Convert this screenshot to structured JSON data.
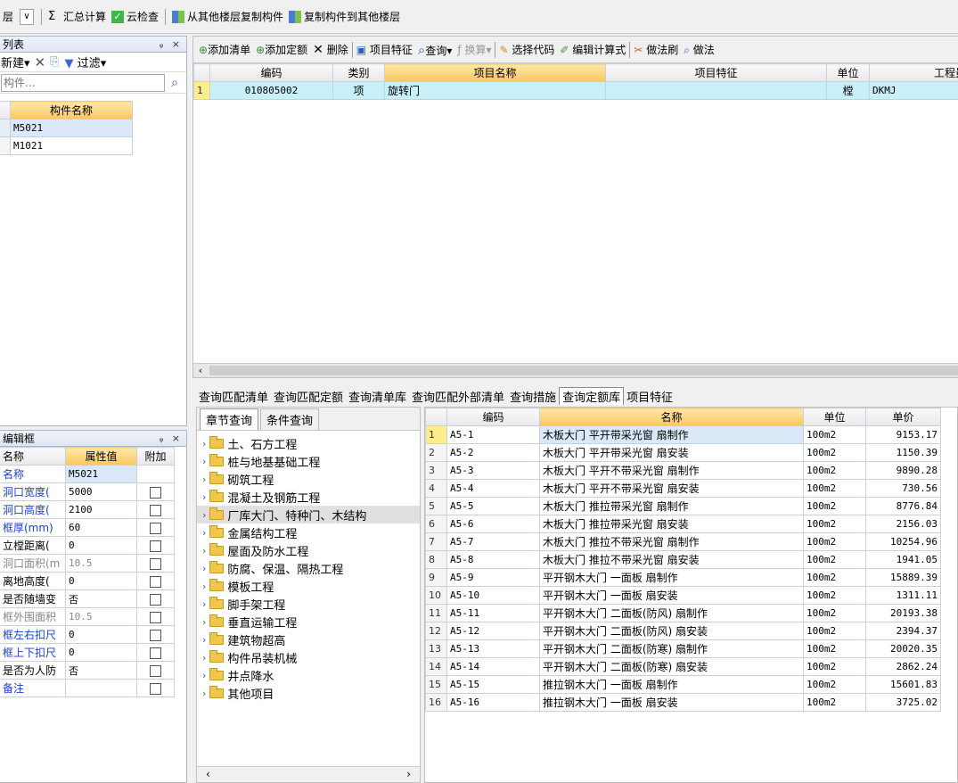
{
  "toolbar": {
    "floor_label": "层",
    "sum_calc": "汇总计算",
    "cloud_check": "云检查",
    "copy_from_floor": "从其他楼层复制构件",
    "copy_to_floor": "复制构件到其他楼层"
  },
  "component_list": {
    "title": "列表",
    "new_label": "新建",
    "filter_label": "过滤",
    "search_placeholder": "构件...",
    "column_header": "构件名称",
    "items": [
      "M5021",
      "M1021"
    ]
  },
  "list_toolbar": {
    "add_list": "添加清单",
    "add_quota": "添加定额",
    "delete": "删除",
    "item_feature": "项目特征",
    "query": "查询",
    "convert": "换算",
    "select_code": "选择代码",
    "edit_formula": "编辑计算式",
    "method_brush": "做法刷",
    "method_query": "做法"
  },
  "list_table": {
    "headers": [
      "编码",
      "类别",
      "项目名称",
      "项目特征",
      "单位",
      "工程量"
    ],
    "rows": [
      {
        "no": "1",
        "code": "010805002",
        "type": "项",
        "name": "旋转门",
        "feature": "",
        "unit": "樘",
        "qty": "DKMJ"
      }
    ]
  },
  "query_tabs": [
    "查询匹配清单",
    "查询匹配定额",
    "查询清单库",
    "查询匹配外部清单",
    "查询措施",
    "查询定额库",
    "项目特征"
  ],
  "active_query_tab": "查询定额库",
  "chapter_tabs": [
    "章节查询",
    "条件查询"
  ],
  "tree": [
    "土、石方工程",
    "桩与地基基础工程",
    "砌筑工程",
    "混凝土及钢筋工程",
    "厂库大门、特种门、木结构",
    "金属结构工程",
    "屋面及防水工程",
    "防腐、保温、隔热工程",
    "模板工程",
    "脚手架工程",
    "垂直运输工程",
    "建筑物超高",
    "构件吊装机械",
    "井点降水",
    "其他项目"
  ],
  "quota_table": {
    "headers": [
      "编码",
      "名称",
      "单位",
      "单价"
    ],
    "rows": [
      {
        "no": "1",
        "code": "A5-1",
        "name": "木板大门 平开带采光窗 扇制作",
        "unit": "100m2",
        "price": "9153.17"
      },
      {
        "no": "2",
        "code": "A5-2",
        "name": "木板大门 平开带采光窗 扇安装",
        "unit": "100m2",
        "price": "1150.39"
      },
      {
        "no": "3",
        "code": "A5-3",
        "name": "木板大门 平开不带采光窗 扇制作",
        "unit": "100m2",
        "price": "9890.28"
      },
      {
        "no": "4",
        "code": "A5-4",
        "name": "木板大门 平开不带采光窗 扇安装",
        "unit": "100m2",
        "price": "730.56"
      },
      {
        "no": "5",
        "code": "A5-5",
        "name": "木板大门 推拉带采光窗 扇制作",
        "unit": "100m2",
        "price": "8776.84"
      },
      {
        "no": "6",
        "code": "A5-6",
        "name": "木板大门 推拉带采光窗 扇安装",
        "unit": "100m2",
        "price": "2156.03"
      },
      {
        "no": "7",
        "code": "A5-7",
        "name": "木板大门 推拉不带采光窗 扇制作",
        "unit": "100m2",
        "price": "10254.96"
      },
      {
        "no": "8",
        "code": "A5-8",
        "name": "木板大门 推拉不带采光窗 扇安装",
        "unit": "100m2",
        "price": "1941.05"
      },
      {
        "no": "9",
        "code": "A5-9",
        "name": "平开钢木大门 一面板 扇制作",
        "unit": "100m2",
        "price": "15889.39"
      },
      {
        "no": "10",
        "code": "A5-10",
        "name": "平开钢木大门 一面板 扇安装",
        "unit": "100m2",
        "price": "1311.11"
      },
      {
        "no": "11",
        "code": "A5-11",
        "name": "平开钢木大门 二面板(防风) 扇制作",
        "unit": "100m2",
        "price": "20193.38"
      },
      {
        "no": "12",
        "code": "A5-12",
        "name": "平开钢木大门 二面板(防风) 扇安装",
        "unit": "100m2",
        "price": "2394.37"
      },
      {
        "no": "13",
        "code": "A5-13",
        "name": "平开钢木大门 二面板(防寒) 扇制作",
        "unit": "100m2",
        "price": "20020.35"
      },
      {
        "no": "14",
        "code": "A5-14",
        "name": "平开钢木大门 二面板(防寒) 扇安装",
        "unit": "100m2",
        "price": "2862.24"
      },
      {
        "no": "15",
        "code": "A5-15",
        "name": "推拉钢木大门 一面板 扇制作",
        "unit": "100m2",
        "price": "15601.83"
      },
      {
        "no": "16",
        "code": "A5-16",
        "name": "推拉钢木大门 一面板 扇安装",
        "unit": "100m2",
        "price": "3725.02"
      }
    ]
  },
  "property_editor": {
    "title": "编辑框",
    "headers": [
      "名称",
      "属性值",
      "附加"
    ],
    "rows": [
      {
        "name": "名称",
        "value": "M5021",
        "style": "blue",
        "check": false,
        "hascheck": false
      },
      {
        "name": "洞口宽度(",
        "value": "5000",
        "style": "blue",
        "check": false,
        "hascheck": true
      },
      {
        "name": "洞口高度(",
        "value": "2100",
        "style": "blue",
        "check": false,
        "hascheck": true
      },
      {
        "name": "框厚(mm)",
        "value": "60",
        "style": "blue",
        "check": false,
        "hascheck": true
      },
      {
        "name": "立樘距离(",
        "value": "0",
        "style": "black",
        "check": false,
        "hascheck": true
      },
      {
        "name": "洞口面积(m",
        "value": "10.5",
        "style": "gray",
        "check": false,
        "hascheck": true
      },
      {
        "name": "离地高度(",
        "value": "0",
        "style": "black",
        "check": false,
        "hascheck": true
      },
      {
        "name": "是否随墙变",
        "value": "否",
        "style": "black",
        "check": false,
        "hascheck": true
      },
      {
        "name": "框外围面积",
        "value": "10.5",
        "style": "gray",
        "check": false,
        "hascheck": true
      },
      {
        "name": "框左右扣尺",
        "value": "0",
        "style": "blue",
        "check": false,
        "hascheck": true
      },
      {
        "name": "框上下扣尺",
        "value": "0",
        "style": "blue",
        "check": false,
        "hascheck": true
      },
      {
        "name": "是否为人防",
        "value": "否",
        "style": "black",
        "check": false,
        "hascheck": true
      },
      {
        "name": "备注",
        "value": "",
        "style": "blue",
        "check": false,
        "hascheck": true
      }
    ]
  }
}
